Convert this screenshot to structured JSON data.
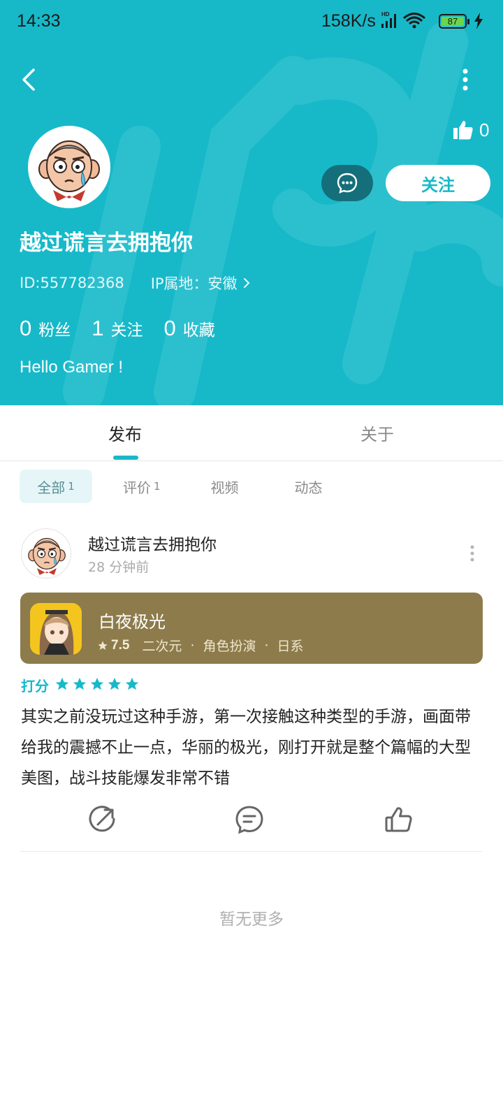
{
  "status_bar": {
    "time": "14:33",
    "network_speed": "158K/s",
    "battery": "87"
  },
  "profile": {
    "like_count": "0",
    "follow_label": "关注",
    "username": "越过谎言去拥抱你",
    "id_text": "ID:557782368",
    "ip_text": "IP属地：安徽",
    "stats": [
      {
        "value": "0",
        "label": "粉丝"
      },
      {
        "value": "1",
        "label": "关注"
      },
      {
        "value": "0",
        "label": "收藏"
      }
    ],
    "bio": "Hello Gamer !"
  },
  "tabs": {
    "publish": "发布",
    "about": "关于"
  },
  "filters": {
    "all_label": "全部",
    "all_count": "1",
    "review_label": "评价",
    "review_count": "1",
    "video_label": "视频",
    "dynamic_label": "动态"
  },
  "post": {
    "author": "越过谎言去拥抱你",
    "time": "28 分钟前",
    "game": {
      "name": "白夜极光",
      "score": "7.5",
      "tags": [
        "二次元",
        "角色扮演",
        "日系"
      ]
    },
    "rating_label": "打分",
    "rating_stars": 5,
    "text": "其实之前没玩过这种手游，第一次接触这种类型的手游，画面带给我的震撼不止一点，华丽的极光，刚打开就是整个篇幅的大型美图，战斗技能爆发非常不错"
  },
  "footer": {
    "no_more": "暂无更多"
  },
  "colors": {
    "accent": "#17b9c9",
    "game_card": "#8d7b4b"
  }
}
